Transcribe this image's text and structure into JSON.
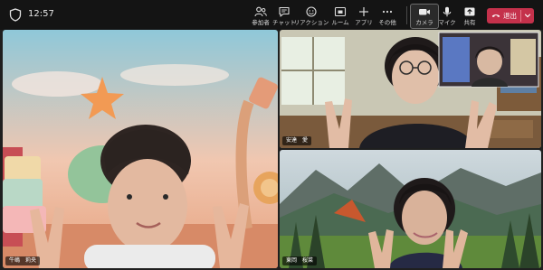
{
  "clock": "12:57",
  "toolbar": {
    "participants": "参加者",
    "chat": "チャット",
    "reactions": "リアクション",
    "rooms": "ルーム",
    "apps": "アプリ",
    "more": "その他",
    "camera": "カメラ",
    "mic": "マイク",
    "share": "共有",
    "leave": "退出"
  },
  "tiles": {
    "main": {
      "name": "牛嶋　莉央"
    },
    "top_right": {
      "name": "安達　愛"
    },
    "bottom_right": {
      "name": "東岡　桜菜"
    }
  },
  "colors": {
    "leave_button": "#c4314b",
    "topbar": "#141414"
  },
  "icons": [
    "shield-icon",
    "participants-icon",
    "chat-icon",
    "reactions-icon",
    "rooms-icon",
    "apps-icon",
    "more-icon",
    "camera-icon",
    "mic-icon",
    "share-icon",
    "phone-icon",
    "chevron-down-icon"
  ]
}
